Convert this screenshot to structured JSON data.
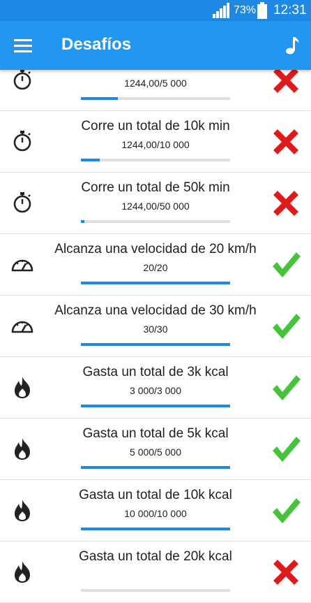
{
  "status_bar": {
    "battery_percent": "73%",
    "time": "12:31"
  },
  "app_bar": {
    "title": "Desafíos",
    "menu_icon": "menu-icon",
    "music_icon": "music-note-icon"
  },
  "colors": {
    "app_bar": "#2196f3",
    "status_bar": "#1e88e5",
    "progress": "#1e88e5",
    "complete": "#43c43a",
    "incomplete": "#e0191b"
  },
  "challenges": [
    {
      "name": "",
      "progress": "1244,00/5 000",
      "fraction": 0.2488,
      "icon": "stopwatch-icon",
      "completed": false
    },
    {
      "name": "Corre un total de 10k min",
      "progress": "1244,00/10 000",
      "fraction": 0.1244,
      "icon": "stopwatch-icon",
      "completed": false
    },
    {
      "name": "Corre un total de 50k min",
      "progress": "1244,00/50 000",
      "fraction": 0.0249,
      "icon": "stopwatch-icon",
      "completed": false
    },
    {
      "name": "Alcanza una velocidad de 20 km/h",
      "progress": "20/20",
      "fraction": 1,
      "icon": "speedometer-icon",
      "completed": true
    },
    {
      "name": "Alcanza una velocidad de 30 km/h",
      "progress": "30/30",
      "fraction": 1,
      "icon": "speedometer-icon",
      "completed": true
    },
    {
      "name": "Gasta un total de 3k kcal",
      "progress": "3 000/3 000",
      "fraction": 1,
      "icon": "flame-icon",
      "completed": true
    },
    {
      "name": "Gasta un total de 5k kcal",
      "progress": "5 000/5 000",
      "fraction": 1,
      "icon": "flame-icon",
      "completed": true
    },
    {
      "name": "Gasta un total de 10k kcal",
      "progress": "10 000/10 000",
      "fraction": 1,
      "icon": "flame-icon",
      "completed": true
    },
    {
      "name": "Gasta un total de 20k kcal",
      "progress": "",
      "fraction": 0,
      "icon": "flame-icon",
      "completed": false
    }
  ]
}
